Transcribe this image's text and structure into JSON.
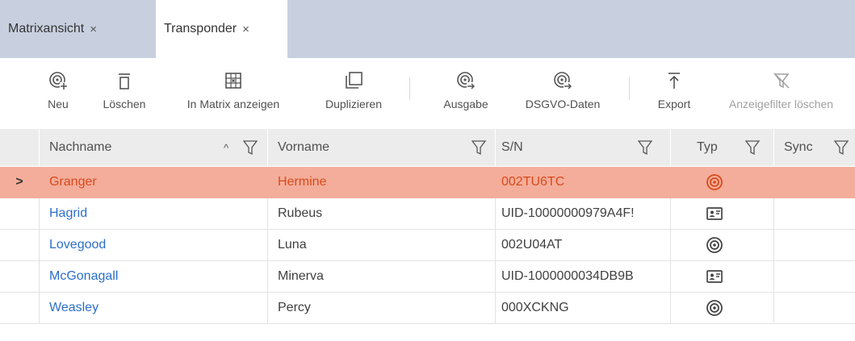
{
  "tabs": [
    {
      "label": "Matrixansicht",
      "close": "×"
    },
    {
      "label": "Transponder",
      "close": "×"
    }
  ],
  "toolbar": {
    "new": "Neu",
    "delete": "Löschen",
    "show_in_matrix": "In Matrix anzeigen",
    "duplicate": "Duplizieren",
    "issue": "Ausgabe",
    "gdpr": "DSGVO-Daten",
    "export": "Export",
    "clear_filter": "Anzeigefilter löschen"
  },
  "columns": {
    "lastname": "Nachname",
    "firstname": "Vorname",
    "serial": "S/N",
    "type": "Typ",
    "sync": "Sync"
  },
  "sort_indicator": "^",
  "selected_row_marker": ">",
  "rows": [
    {
      "lastname": "Granger",
      "firstname": "Hermine",
      "serial": "002TU6TC",
      "type_icon": "transponder-icon",
      "sync": "",
      "selected": true
    },
    {
      "lastname": "Hagrid",
      "firstname": "Rubeus",
      "serial": "UID-10000000979A4F!",
      "type_icon": "card-icon",
      "sync": ""
    },
    {
      "lastname": "Lovegood",
      "firstname": "Luna",
      "serial": "002U04AT",
      "type_icon": "transponder-icon",
      "sync": ""
    },
    {
      "lastname": "McGonagall",
      "firstname": "Minerva",
      "serial": "UID-1000000034DB9B",
      "type_icon": "card-icon",
      "sync": ""
    },
    {
      "lastname": "Weasley",
      "firstname": "Percy",
      "serial": "000XCKNG",
      "type_icon": "transponder-icon",
      "sync": ""
    }
  ],
  "colors": {
    "accent_selection": "#f4ad9a",
    "selected_text": "#d84a1c",
    "link_text": "#2c6fc9",
    "tabbar_bg": "#c8d0e0"
  }
}
